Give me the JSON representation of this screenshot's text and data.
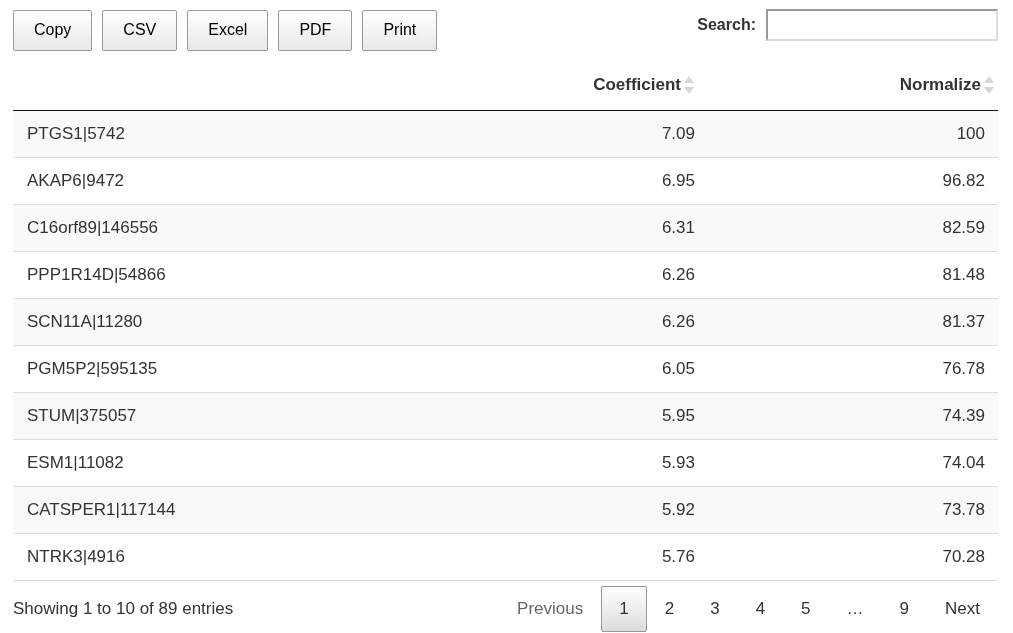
{
  "buttons": [
    "Copy",
    "CSV",
    "Excel",
    "PDF",
    "Print"
  ],
  "search": {
    "label": "Search:"
  },
  "table": {
    "columns": [
      "Coefficient",
      "Normalize"
    ],
    "rows": [
      {
        "name": "PTGS1|5742",
        "coefficient": "7.09",
        "normalize": "100"
      },
      {
        "name": "AKAP6|9472",
        "coefficient": "6.95",
        "normalize": "96.82"
      },
      {
        "name": "C16orf89|146556",
        "coefficient": "6.31",
        "normalize": "82.59"
      },
      {
        "name": "PPP1R14D|54866",
        "coefficient": "6.26",
        "normalize": "81.48"
      },
      {
        "name": "SCN11A|11280",
        "coefficient": "6.26",
        "normalize": "81.37"
      },
      {
        "name": "PGM5P2|595135",
        "coefficient": "6.05",
        "normalize": "76.78"
      },
      {
        "name": "STUM|375057",
        "coefficient": "5.95",
        "normalize": "74.39"
      },
      {
        "name": "ESM1|11082",
        "coefficient": "5.93",
        "normalize": "74.04"
      },
      {
        "name": "CATSPER1|117144",
        "coefficient": "5.92",
        "normalize": "73.78"
      },
      {
        "name": "NTRK3|4916",
        "coefficient": "5.76",
        "normalize": "70.28"
      }
    ]
  },
  "info": "Showing 1 to 10 of 89 entries",
  "pagination": [
    {
      "label": "Previous",
      "kind": "nav",
      "disabled": true
    },
    {
      "label": "1",
      "kind": "page",
      "selected": true
    },
    {
      "label": "2",
      "kind": "page",
      "selected": false
    },
    {
      "label": "3",
      "kind": "page",
      "selected": false
    },
    {
      "label": "4",
      "kind": "page",
      "selected": false
    },
    {
      "label": "5",
      "kind": "page",
      "selected": false
    },
    {
      "label": "…",
      "kind": "ellipsis"
    },
    {
      "label": "9",
      "kind": "page",
      "selected": false
    },
    {
      "label": "Next",
      "kind": "nav",
      "disabled": false
    }
  ]
}
